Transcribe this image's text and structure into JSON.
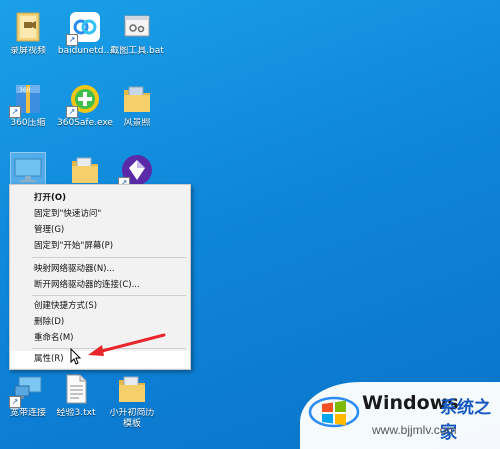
{
  "desktop": {
    "icons": [
      {
        "label": "录屏视频",
        "icon": "folder-video-icon"
      },
      {
        "label": "baidunetd...",
        "icon": "baidu-netdisk-icon"
      },
      {
        "label": "截图工具.bat",
        "icon": "bat-file-icon"
      },
      {
        "label": "360压缩",
        "icon": "360-zip-icon"
      },
      {
        "label": "360Safe.exe",
        "icon": "360-safe-icon"
      },
      {
        "label": "风景照",
        "icon": "folder-icon"
      },
      {
        "label": "",
        "icon": "this-pc-icon"
      },
      {
        "label": "",
        "icon": "folder-icon"
      },
      {
        "label": "",
        "icon": "app-diamond-icon"
      },
      {
        "label": "宽带连接",
        "icon": "broadband-connection-icon"
      },
      {
        "label": "经验3.txt",
        "icon": "text-file-icon"
      },
      {
        "label": "小升初简历模板",
        "icon": "folder-icon"
      }
    ]
  },
  "context_menu": {
    "items": [
      {
        "label": "打开(O)",
        "bold": true
      },
      {
        "label": "固定到\"快速访问\""
      },
      {
        "label": "管理(G)"
      },
      {
        "label": "固定到\"开始\"屏幕(P)"
      },
      {
        "label": "映射网络驱动器(N)..."
      },
      {
        "label": "断开网络驱动器的连接(C)..."
      },
      {
        "label": "创建快捷方式(S)"
      },
      {
        "label": "删除(D)"
      },
      {
        "label": "重命名(M)"
      },
      {
        "label": "属性(R)",
        "highlighted": true
      }
    ]
  },
  "watermark": {
    "brand": "Windows",
    "suffix": "系统之家",
    "url": "www.bjjmlv.com"
  },
  "colors": {
    "desktop_bg": "#1187dc",
    "arrow": "#e8262b",
    "menu_bg": "#f2f2f2",
    "watermark_blue": "#1557c0"
  }
}
